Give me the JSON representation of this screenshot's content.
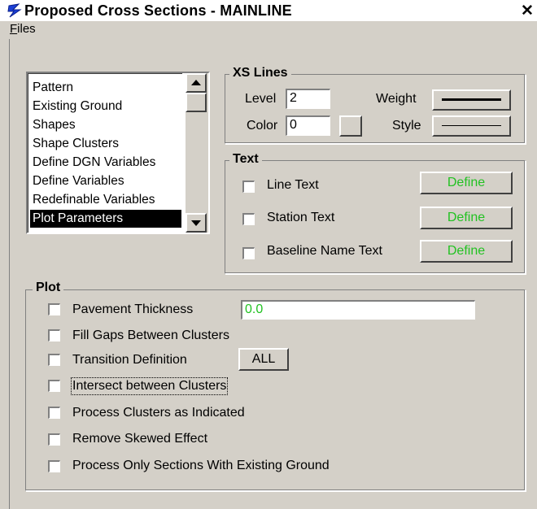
{
  "window": {
    "title": "Proposed Cross Sections - MAINLINE",
    "close_label": "✕"
  },
  "menu": {
    "files_first": "F",
    "files_rest": "iles"
  },
  "list": {
    "items": [
      "Pattern",
      "Existing Ground",
      "Shapes",
      "Shape Clusters",
      "Define DGN Variables",
      "Define Variables",
      "Redefinable Variables",
      "Plot Parameters"
    ],
    "selected": "Plot Parameters"
  },
  "xs_lines": {
    "title": "XS Lines",
    "level_label": "Level",
    "level_value": "2",
    "color_label": "Color",
    "color_value": "0",
    "weight_label": "Weight",
    "style_label": "Style"
  },
  "text_group": {
    "title": "Text",
    "rows": [
      {
        "label": "Line Text",
        "button": "Define"
      },
      {
        "label": "Station Text",
        "button": "Define"
      },
      {
        "label": "Baseline Name Text",
        "button": "Define"
      }
    ]
  },
  "plot": {
    "title": "Plot",
    "pavement_thickness_label": "Pavement Thickness",
    "pavement_thickness_value": "0.0",
    "fill_gaps_label": "Fill Gaps Between Clusters",
    "transition_label": "Transition Definition",
    "transition_button": "ALL",
    "intersect_label": "Intersect between Clusters",
    "process_clusters_label": "Process Clusters as Indicated",
    "remove_skewed_label": "Remove Skewed Effect",
    "process_only_label": "Process Only Sections With Existing Ground"
  },
  "colors": {
    "define_text": "#22c222",
    "selection_bg": "#000000",
    "window_bg": "#d4d0c8",
    "app_icon": "#1b3fd6"
  },
  "icons": {
    "app": "s-curve-app-icon",
    "close": "close-icon"
  }
}
